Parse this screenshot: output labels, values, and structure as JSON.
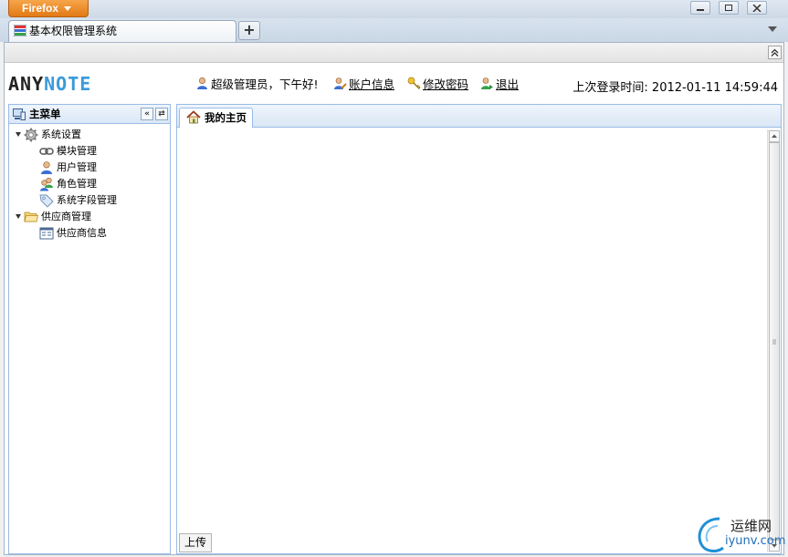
{
  "browser": {
    "menu_button": "Firefox",
    "tab_title": "基本权限管理系统",
    "new_tab_label": "+"
  },
  "header": {
    "logo_part1": "ANY",
    "logo_part2": "NOTE",
    "greeting": "超级管理员，下午好!",
    "account_info": "账户信息",
    "change_password": "修改密码",
    "logout": "退出",
    "last_login": "上次登录时间: 2012-01-11 14:59:44"
  },
  "menu": {
    "title": "主菜单",
    "collapse_label": "«",
    "refresh_label": "⇄",
    "items": [
      {
        "label": "系统设置",
        "icon": "gear-icon"
      },
      {
        "label": "模块管理",
        "icon": "link-icon"
      },
      {
        "label": "用户管理",
        "icon": "user-icon"
      },
      {
        "label": "角色管理",
        "icon": "users-icon"
      },
      {
        "label": "系统字段管理",
        "icon": "tag-icon"
      },
      {
        "label": "供应商管理",
        "icon": "folder-icon"
      },
      {
        "label": "供应商信息",
        "icon": "form-icon"
      }
    ]
  },
  "main": {
    "home_tab": "我的主页",
    "upload_button": "上传"
  },
  "watermark": {
    "name": "运维网",
    "url": "iyunv.com"
  },
  "colors": {
    "firefox_orange": "#e27a16",
    "logo_blue": "#3a9ad9",
    "panel_border": "#99bbe8"
  }
}
